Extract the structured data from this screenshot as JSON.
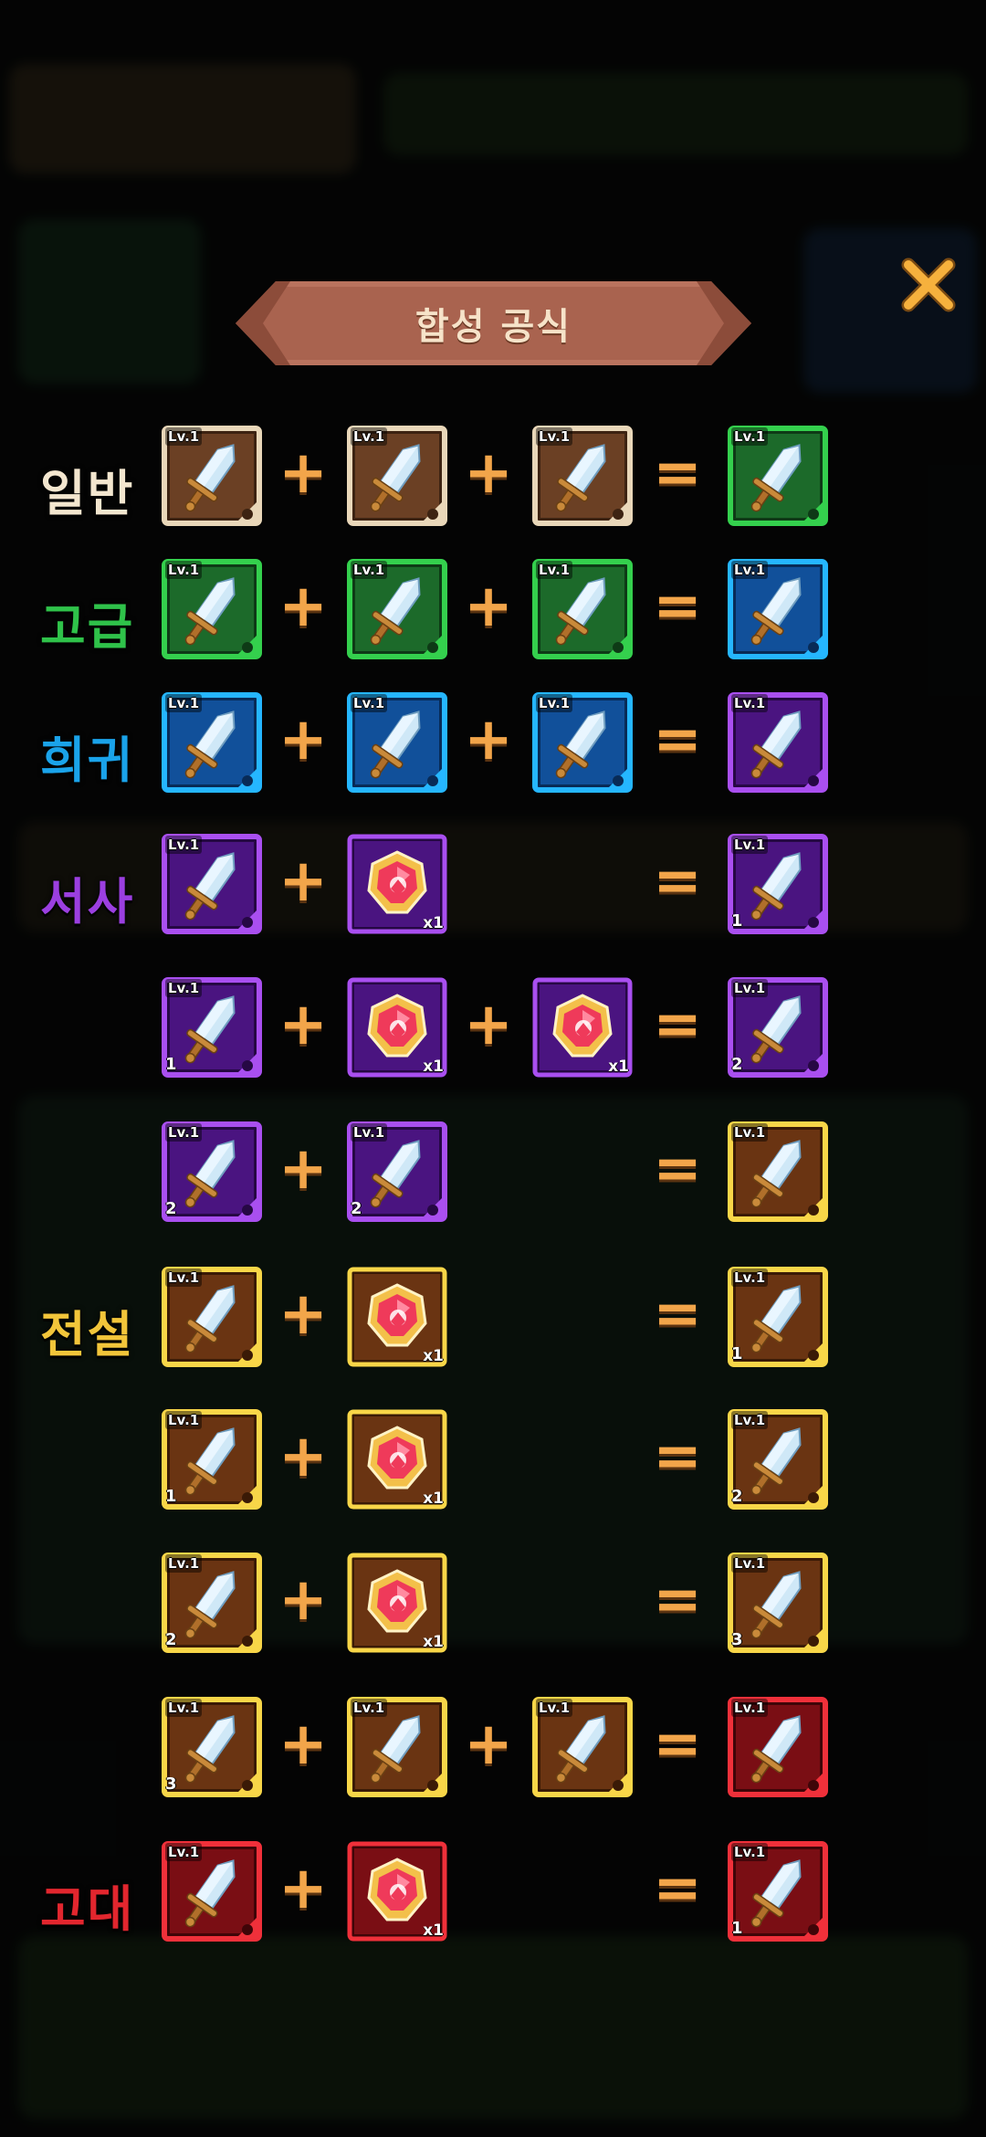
{
  "title": "합성 공식",
  "close_icon": "close-x-icon",
  "colors": {
    "common": "#c9a27a",
    "uncommon": "#2fc24a",
    "rare": "#1aa3ea",
    "epic": "#9b3fe0",
    "legendary": "#f2c53a",
    "ancient": "#e2262e",
    "operator": "#f2a54a"
  },
  "tier_labels": {
    "common": "일반",
    "uncommon": "고급",
    "rare": "희귀",
    "epic": "서사",
    "legendary": "전설",
    "ancient": "고대"
  },
  "level_text": "Lv.1",
  "gem_count_text": "x1",
  "plus": "+",
  "equals": "=",
  "recipes": [
    {
      "tier_label": "일반",
      "label_color": "#f3e6cf",
      "inputs": [
        {
          "kind": "weapon",
          "rarity": "common",
          "star": ""
        },
        {
          "kind": "weapon",
          "rarity": "common",
          "star": ""
        },
        {
          "kind": "weapon",
          "rarity": "common",
          "star": ""
        }
      ],
      "output": {
        "kind": "weapon",
        "rarity": "uncommon",
        "star": ""
      }
    },
    {
      "tier_label": "고급",
      "label_color": "#2fc24a",
      "inputs": [
        {
          "kind": "weapon",
          "rarity": "uncommon",
          "star": ""
        },
        {
          "kind": "weapon",
          "rarity": "uncommon",
          "star": ""
        },
        {
          "kind": "weapon",
          "rarity": "uncommon",
          "star": ""
        }
      ],
      "output": {
        "kind": "weapon",
        "rarity": "rare",
        "star": ""
      }
    },
    {
      "tier_label": "희귀",
      "label_color": "#1aa3ea",
      "inputs": [
        {
          "kind": "weapon",
          "rarity": "rare",
          "star": ""
        },
        {
          "kind": "weapon",
          "rarity": "rare",
          "star": ""
        },
        {
          "kind": "weapon",
          "rarity": "rare",
          "star": ""
        }
      ],
      "output": {
        "kind": "weapon",
        "rarity": "epic",
        "star": ""
      }
    },
    {
      "tier_label": "서사",
      "label_color": "#9b3fe0",
      "inputs": [
        {
          "kind": "weapon",
          "rarity": "epic",
          "star": ""
        },
        {
          "kind": "gem",
          "rarity": "epic",
          "star": ""
        }
      ],
      "output": {
        "kind": "weapon",
        "rarity": "epic",
        "star": "1"
      }
    },
    {
      "tier_label": "",
      "label_color": "#9b3fe0",
      "inputs": [
        {
          "kind": "weapon",
          "rarity": "epic",
          "star": "1"
        },
        {
          "kind": "gem",
          "rarity": "epic",
          "star": ""
        },
        {
          "kind": "gem",
          "rarity": "epic",
          "star": ""
        }
      ],
      "output": {
        "kind": "weapon",
        "rarity": "epic",
        "star": "2"
      }
    },
    {
      "tier_label": "",
      "label_color": "#9b3fe0",
      "inputs": [
        {
          "kind": "weapon",
          "rarity": "epic",
          "star": "2"
        },
        {
          "kind": "weapon",
          "rarity": "epic",
          "star": "2"
        }
      ],
      "output": {
        "kind": "weapon",
        "rarity": "legendary",
        "star": ""
      }
    },
    {
      "tier_label": "전설",
      "label_color": "#f2c53a",
      "inputs": [
        {
          "kind": "weapon",
          "rarity": "legendary",
          "star": ""
        },
        {
          "kind": "gem",
          "rarity": "legendary",
          "star": ""
        }
      ],
      "output": {
        "kind": "weapon",
        "rarity": "legendary",
        "star": "1"
      }
    },
    {
      "tier_label": "",
      "label_color": "#f2c53a",
      "inputs": [
        {
          "kind": "weapon",
          "rarity": "legendary",
          "star": "1"
        },
        {
          "kind": "gem",
          "rarity": "legendary",
          "star": ""
        }
      ],
      "output": {
        "kind": "weapon",
        "rarity": "legendary",
        "star": "2"
      }
    },
    {
      "tier_label": "",
      "label_color": "#f2c53a",
      "inputs": [
        {
          "kind": "weapon",
          "rarity": "legendary",
          "star": "2"
        },
        {
          "kind": "gem",
          "rarity": "legendary",
          "star": ""
        }
      ],
      "output": {
        "kind": "weapon",
        "rarity": "legendary",
        "star": "3"
      }
    },
    {
      "tier_label": "",
      "label_color": "#f2c53a",
      "inputs": [
        {
          "kind": "weapon",
          "rarity": "legendary",
          "star": "3"
        },
        {
          "kind": "weapon",
          "rarity": "legendary",
          "star": ""
        },
        {
          "kind": "weapon",
          "rarity": "legendary",
          "star": ""
        }
      ],
      "output": {
        "kind": "weapon",
        "rarity": "ancient",
        "star": ""
      }
    },
    {
      "tier_label": "고대",
      "label_color": "#e2262e",
      "inputs": [
        {
          "kind": "weapon",
          "rarity": "ancient",
          "star": ""
        },
        {
          "kind": "gem",
          "rarity": "ancient",
          "star": ""
        }
      ],
      "output": {
        "kind": "weapon",
        "rarity": "ancient",
        "star": "1"
      }
    }
  ]
}
